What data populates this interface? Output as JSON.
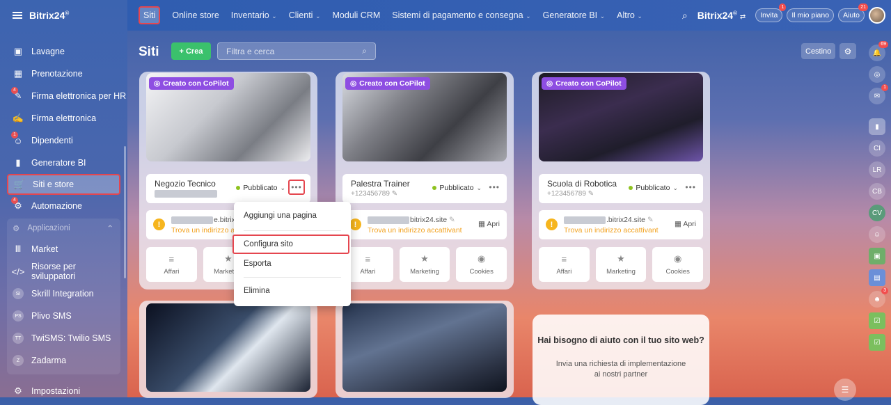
{
  "app": {
    "brand": "Bitrix24",
    "brand_mark": "©"
  },
  "sidebar": {
    "items": [
      {
        "label": "Lavagne",
        "icon": "board-icon"
      },
      {
        "label": "Prenotazione",
        "icon": "calendar-icon"
      },
      {
        "label": "Firma elettronica per HR",
        "icon": "signature-hr-icon",
        "badge": "4"
      },
      {
        "label": "Firma elettronica",
        "icon": "pen-icon"
      },
      {
        "label": "Dipendenti",
        "icon": "employees-icon",
        "badge": "1"
      },
      {
        "label": "Generatore BI",
        "icon": "bar-chart-icon"
      },
      {
        "label": "Siti e store",
        "icon": "cart-icon"
      },
      {
        "label": "Automazione",
        "icon": "automation-icon",
        "badge": "4"
      }
    ],
    "group_label": "Applicazioni",
    "apps": [
      {
        "label": "Market",
        "icon": "market-icon"
      },
      {
        "label": "Risorse per sviluppatori",
        "icon": "code-icon"
      },
      {
        "label": "Skrill Integration",
        "avatar": "SI"
      },
      {
        "label": "Plivo SMS",
        "avatar": "PS"
      },
      {
        "label": "TwiSMS: Twilio SMS",
        "avatar": "TT"
      },
      {
        "label": "Zadarma",
        "avatar": "Z"
      }
    ],
    "settings": "Impostazioni"
  },
  "topnav": {
    "items": [
      "Siti",
      "Online store",
      "Inventario",
      "Clienti",
      "Moduli CRM",
      "Sistemi di pagamento e consegna",
      "Generatore BI",
      "Altro"
    ],
    "invite": "Invita",
    "invite_badge": "1",
    "plan": "Il mio piano",
    "help": "Aiuto",
    "help_badge": "21"
  },
  "page": {
    "title": "Siti",
    "create": "Crea",
    "search_placeholder": "Filtra e cerca",
    "trash": "Cestino"
  },
  "cards": [
    {
      "badge": "Creato con CoPilot",
      "name": "Negozio Tecnico",
      "phone": "",
      "status": "Pubblicato",
      "domain": "e.bitrix24.s",
      "warning": "Trova un indirizzo acc",
      "open": ""
    },
    {
      "badge": "Creato con CoPilot",
      "name": "Palestra Trainer",
      "phone": "+123456789",
      "status": "Pubblicato",
      "domain": "bitrix24.site",
      "warning": "Trova un indirizzo accattivante ...",
      "open": "Apri"
    },
    {
      "badge": "Creato con CoPilot",
      "name": "Scuola di Robotica",
      "phone": "+123456789",
      "status": "Pubblicato",
      "domain": ".bitrix24.site",
      "warning": "Trova un indirizzo accattivante ...",
      "open": "Apri"
    }
  ],
  "card_actions": [
    "Affari",
    "Marketing",
    "Cookies"
  ],
  "menu": {
    "items": [
      "Aggiungi una pagina",
      "Configura sito",
      "Esporta",
      "Elimina"
    ]
  },
  "help": {
    "title": "Hai bisogno di aiuto con il tuo sito web?",
    "text": "Invia una richiesta di implementazione ai nostri partner"
  },
  "rail": {
    "notifications_badge": "69",
    "chat_badge": "1",
    "avatars": [
      "CI",
      "LR",
      "CB",
      "CV"
    ],
    "avatar_badge": "3"
  },
  "colors": {
    "accent_green": "#3bc16c",
    "copilot": "#8e4ee2",
    "highlight": "#e5464f",
    "warning": "#f6b51e"
  }
}
